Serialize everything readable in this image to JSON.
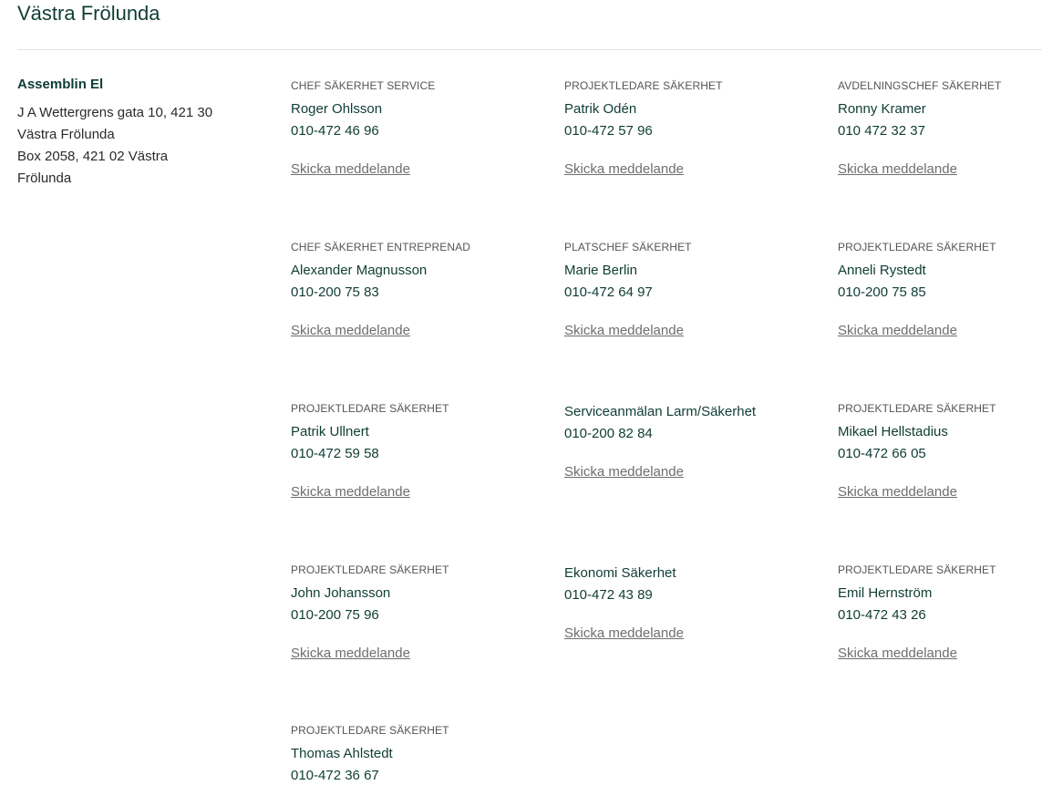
{
  "header": {
    "title": "Västra Frölunda"
  },
  "company": {
    "name": "Assemblin El",
    "address_lines": [
      "J A Wettergrens gata 10, 421 30",
      "Västra Frölunda",
      "Box 2058, 421 02 Västra",
      "Frölunda"
    ]
  },
  "contacts": [
    {
      "role": "CHEF SÄKERHET SERVICE",
      "name": "Roger Ohlsson",
      "phone": "010-472 46 96",
      "link": "Skicka meddelande"
    },
    {
      "role": "PROJEKTLEDARE SÄKERHET",
      "name": "Patrik Odén",
      "phone": "010-472 57 96",
      "link": "Skicka meddelande"
    },
    {
      "role": "AVDELNINGSCHEF SÄKERHET",
      "name": "Ronny Kramer",
      "phone": "010 472 32 37",
      "link": "Skicka meddelande"
    },
    {
      "role": "CHEF SÄKERHET ENTREPRENAD",
      "name": "Alexander Magnusson",
      "phone": "010-200 75 83",
      "link": "Skicka meddelande"
    },
    {
      "role": "PLATSCHEF SÄKERHET",
      "name": "Marie Berlin",
      "phone": "010-472 64 97",
      "link": "Skicka meddelande"
    },
    {
      "role": "PROJEKTLEDARE SÄKERHET",
      "name": "Anneli Rystedt",
      "phone": "010-200 75 85",
      "link": "Skicka meddelande"
    },
    {
      "role": "PROJEKTLEDARE SÄKERHET",
      "name": "Patrik Ullnert",
      "phone": "010-472 59 58",
      "link": "Skicka meddelande"
    },
    {
      "role": "",
      "name": "Serviceanmälan Larm/Säkerhet",
      "phone": "010-200 82 84",
      "link": "Skicka meddelande"
    },
    {
      "role": "PROJEKTLEDARE SÄKERHET",
      "name": "Mikael Hellstadius",
      "phone": "010-472 66 05",
      "link": "Skicka meddelande"
    },
    {
      "role": "PROJEKTLEDARE SÄKERHET",
      "name": "John Johansson",
      "phone": "010-200 75 96",
      "link": "Skicka meddelande"
    },
    {
      "role": "",
      "name": "Ekonomi Säkerhet",
      "phone": "010-472 43 89",
      "link": "Skicka meddelande"
    },
    {
      "role": "PROJEKTLEDARE SÄKERHET",
      "name": "Emil Hernström",
      "phone": "010-472 43 26",
      "link": "Skicka meddelande"
    },
    {
      "role": "PROJEKTLEDARE SÄKERHET",
      "name": "Thomas Ahlstedt",
      "phone": "010-472 36 67",
      "link": ""
    }
  ]
}
